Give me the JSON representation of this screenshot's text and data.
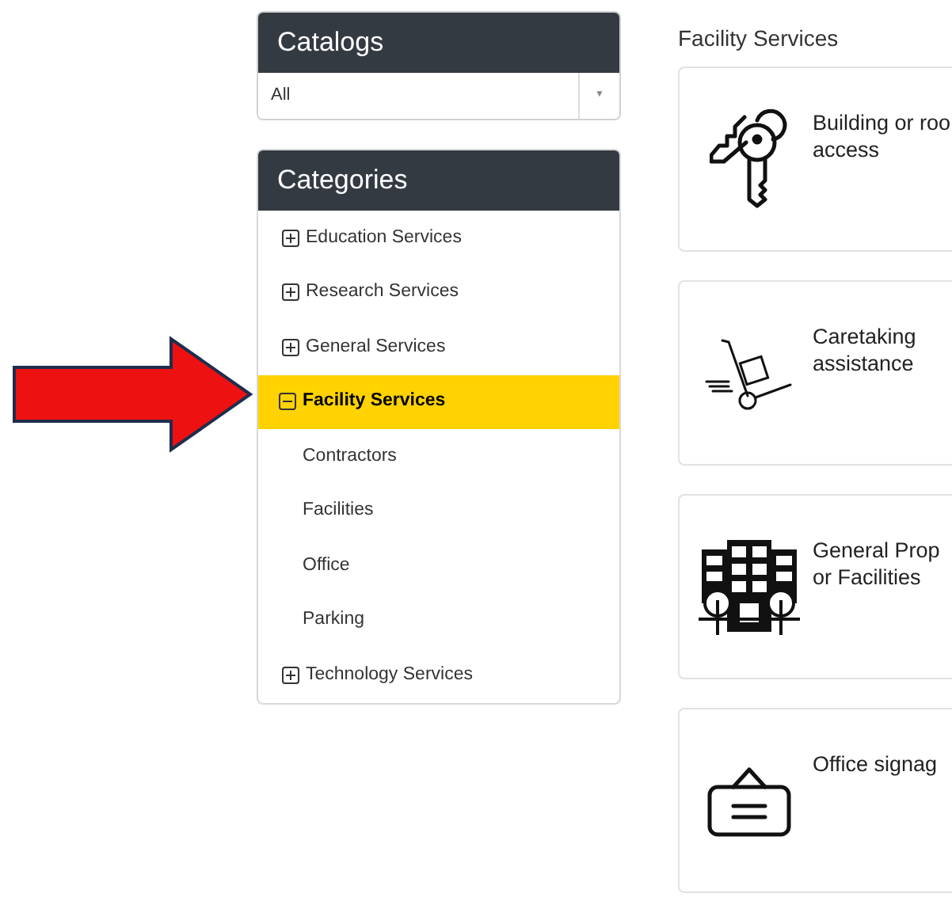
{
  "catalogs": {
    "title": "Catalogs",
    "select": {
      "value": "All",
      "caret": "▼"
    }
  },
  "categories": {
    "title": "Categories",
    "items": [
      {
        "label": "Education Services",
        "expanded": false,
        "selected": false
      },
      {
        "label": "Research Services",
        "expanded": false,
        "selected": false
      },
      {
        "label": "General Services",
        "expanded": false,
        "selected": false
      },
      {
        "label": "Facility Services",
        "expanded": true,
        "selected": true,
        "children": [
          {
            "label": "Contractors",
            "selected": false
          },
          {
            "label": "Facilities",
            "selected": false
          },
          {
            "label": "Office",
            "selected": false
          },
          {
            "label": "Parking",
            "selected": false
          }
        ]
      },
      {
        "label": "Technology Services",
        "expanded": false,
        "selected": false
      }
    ]
  },
  "content": {
    "heading": "Facility Services",
    "cards": [
      {
        "kind": "keys",
        "lines": [
          "Building or roo",
          "access"
        ]
      },
      {
        "kind": "cart",
        "lines": [
          "Caretaking",
          "assistance"
        ]
      },
      {
        "kind": "building",
        "lines": [
          "General Prop",
          "or Facilities"
        ]
      },
      {
        "kind": "sign",
        "lines": [
          "Office signag"
        ]
      }
    ]
  }
}
